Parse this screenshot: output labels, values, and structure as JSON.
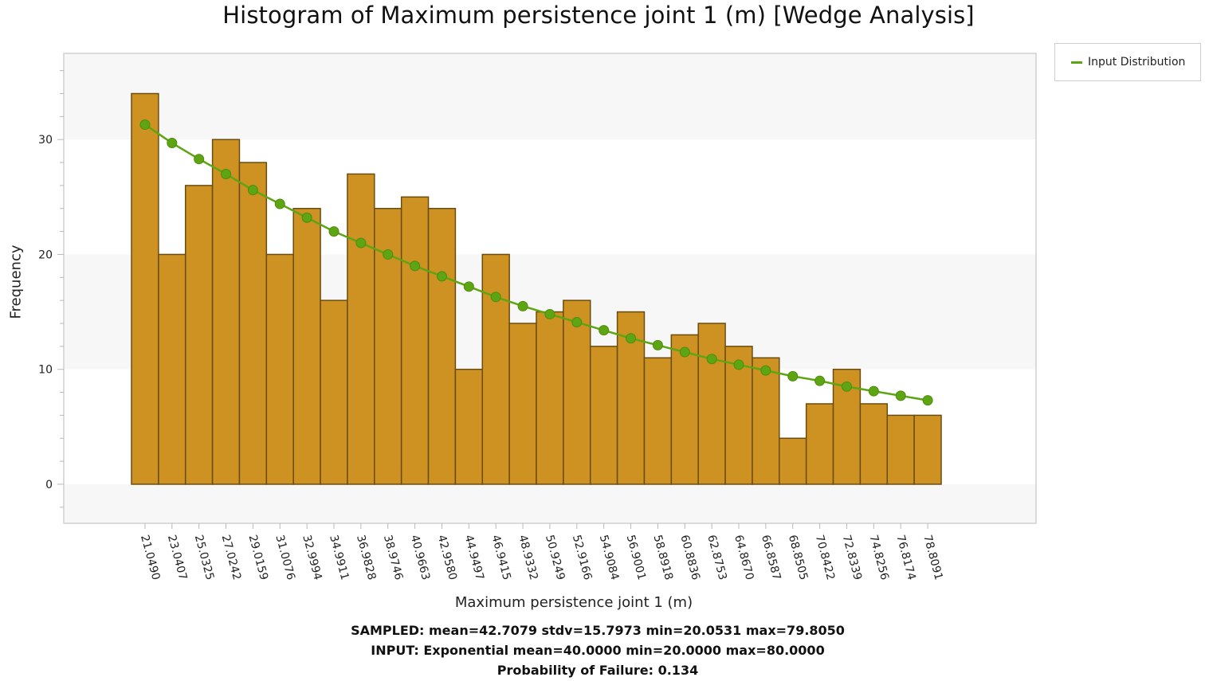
{
  "chart_data": {
    "type": "bar",
    "title": "Histogram of Maximum persistence joint 1 (m) [Wedge Analysis]",
    "xlabel": "Maximum persistence joint 1 (m)",
    "ylabel": "Frequency",
    "ylim": [
      -3.4,
      37.5
    ],
    "yticks": [
      0,
      10,
      20,
      30
    ],
    "ytick_labels": [
      "0",
      "10",
      "20",
      "30"
    ],
    "y_minor_step": 2,
    "grid": "alternating horizontal bands",
    "legend_position": "top-right (outside plot)",
    "categories": [
      "21.0490",
      "23.0407",
      "25.0325",
      "27.0242",
      "29.0159",
      "31.0076",
      "32.9994",
      "34.9911",
      "36.9828",
      "38.9746",
      "40.9663",
      "42.9580",
      "44.9497",
      "46.9415",
      "48.9332",
      "50.9249",
      "52.9166",
      "54.9084",
      "56.9001",
      "58.8918",
      "60.8836",
      "62.8753",
      "64.8670",
      "66.8587",
      "68.8505",
      "70.8422",
      "72.8339",
      "74.8256",
      "76.8174",
      "78.8091"
    ],
    "series": [
      {
        "name": "Sampled",
        "kind": "bar",
        "color": "#cd9221",
        "edge_color": "#6b4c10",
        "values": [
          34,
          20,
          26,
          30,
          28,
          20,
          24,
          16,
          27,
          24,
          25,
          24,
          10,
          20,
          14,
          15,
          16,
          12,
          15,
          11,
          13,
          14,
          12,
          11,
          4,
          7,
          10,
          7,
          6,
          6
        ]
      },
      {
        "name": "Input Distribution",
        "kind": "line",
        "color": "#5ea514",
        "marker": "circle",
        "values": [
          31.3,
          29.7,
          28.3,
          27.0,
          25.6,
          24.4,
          23.2,
          22.0,
          21.0,
          20.0,
          19.0,
          18.1,
          17.2,
          16.3,
          15.5,
          14.8,
          14.1,
          13.4,
          12.7,
          12.1,
          11.5,
          10.9,
          10.4,
          9.9,
          9.4,
          9.0,
          8.5,
          8.1,
          7.7,
          7.3
        ]
      }
    ]
  },
  "legend": {
    "items": [
      {
        "label": "Input Distribution",
        "color": "#5ea514"
      }
    ]
  },
  "stats": {
    "sampled": "SAMPLED: mean=42.7079 stdv=15.7973 min=20.0531 max=79.8050",
    "input": "INPUT: Exponential mean=40.0000 min=20.0000 max=80.0000",
    "pof": "Probability of Failure: 0.134"
  }
}
